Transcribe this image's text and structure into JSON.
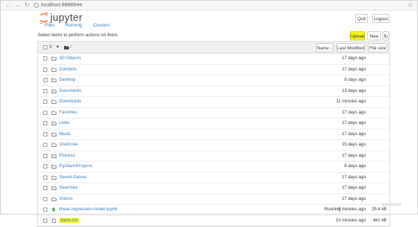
{
  "browser": {
    "url": "localhost:8888/tree",
    "back_icon": "arrow-left",
    "forward_icon": "arrow-right",
    "reload_icon": "reload"
  },
  "header": {
    "logo_text": "jupyter",
    "quit_label": "Quit",
    "logout_label": "Logout"
  },
  "tabs": [
    "Files",
    "Running",
    "Clusters"
  ],
  "toolbar": {
    "prompt": "Select items to perform actions on them.",
    "upload_label": "Upload",
    "new_label": "New ▾",
    "refresh_icon": "refresh"
  },
  "list_header": {
    "count": "0",
    "dropdown_caret": "▾",
    "breadcrumb_slash": "/",
    "name_label": "Name ↓",
    "last_modified_label": "Last Modified",
    "file_size_label": "File size"
  },
  "files": [
    {
      "name": "3D Objects",
      "type": "folder",
      "status": "",
      "modified": "17 days ago",
      "size": ""
    },
    {
      "name": "Contacts",
      "type": "folder",
      "status": "",
      "modified": "17 days ago",
      "size": ""
    },
    {
      "name": "Desktop",
      "type": "folder",
      "status": "",
      "modified": "8 days ago",
      "size": ""
    },
    {
      "name": "Documents",
      "type": "folder",
      "status": "",
      "modified": "13 days ago",
      "size": ""
    },
    {
      "name": "Downloads",
      "type": "folder",
      "status": "",
      "modified": "11 minutes ago",
      "size": ""
    },
    {
      "name": "Favorites",
      "type": "folder",
      "status": "",
      "modified": "17 days ago",
      "size": ""
    },
    {
      "name": "Links",
      "type": "folder",
      "status": "",
      "modified": "17 days ago",
      "size": ""
    },
    {
      "name": "Music",
      "type": "folder",
      "status": "",
      "modified": "17 days ago",
      "size": ""
    },
    {
      "name": "OneDrive",
      "type": "folder",
      "status": "",
      "modified": "15 days ago",
      "size": ""
    },
    {
      "name": "Pictures",
      "type": "folder",
      "status": "",
      "modified": "17 days ago",
      "size": ""
    },
    {
      "name": "PycharmProjects",
      "type": "folder",
      "status": "",
      "modified": "8 days ago",
      "size": ""
    },
    {
      "name": "Saved Games",
      "type": "folder",
      "status": "",
      "modified": "17 days ago",
      "size": ""
    },
    {
      "name": "Searches",
      "type": "folder",
      "status": "",
      "modified": "17 days ago",
      "size": ""
    },
    {
      "name": "Videos",
      "type": "folder",
      "status": "",
      "modified": "17 days ago",
      "size": ""
    },
    {
      "name": "linear-regression-model.ipynb",
      "type": "notebook",
      "status": "Running",
      "modified": "6 minutes ago",
      "size": "25.4 kB"
    },
    {
      "name": "bank.csv",
      "type": "file",
      "status": "",
      "modified": "10 minutes ago",
      "size": "461 kB",
      "highlighted": true
    }
  ],
  "watermark": "Windows",
  "colors": {
    "link": "#337ab7",
    "highlight": "#f5f51a",
    "notebook_icon": "#5cb85c",
    "logo_orange": "#f37726"
  }
}
